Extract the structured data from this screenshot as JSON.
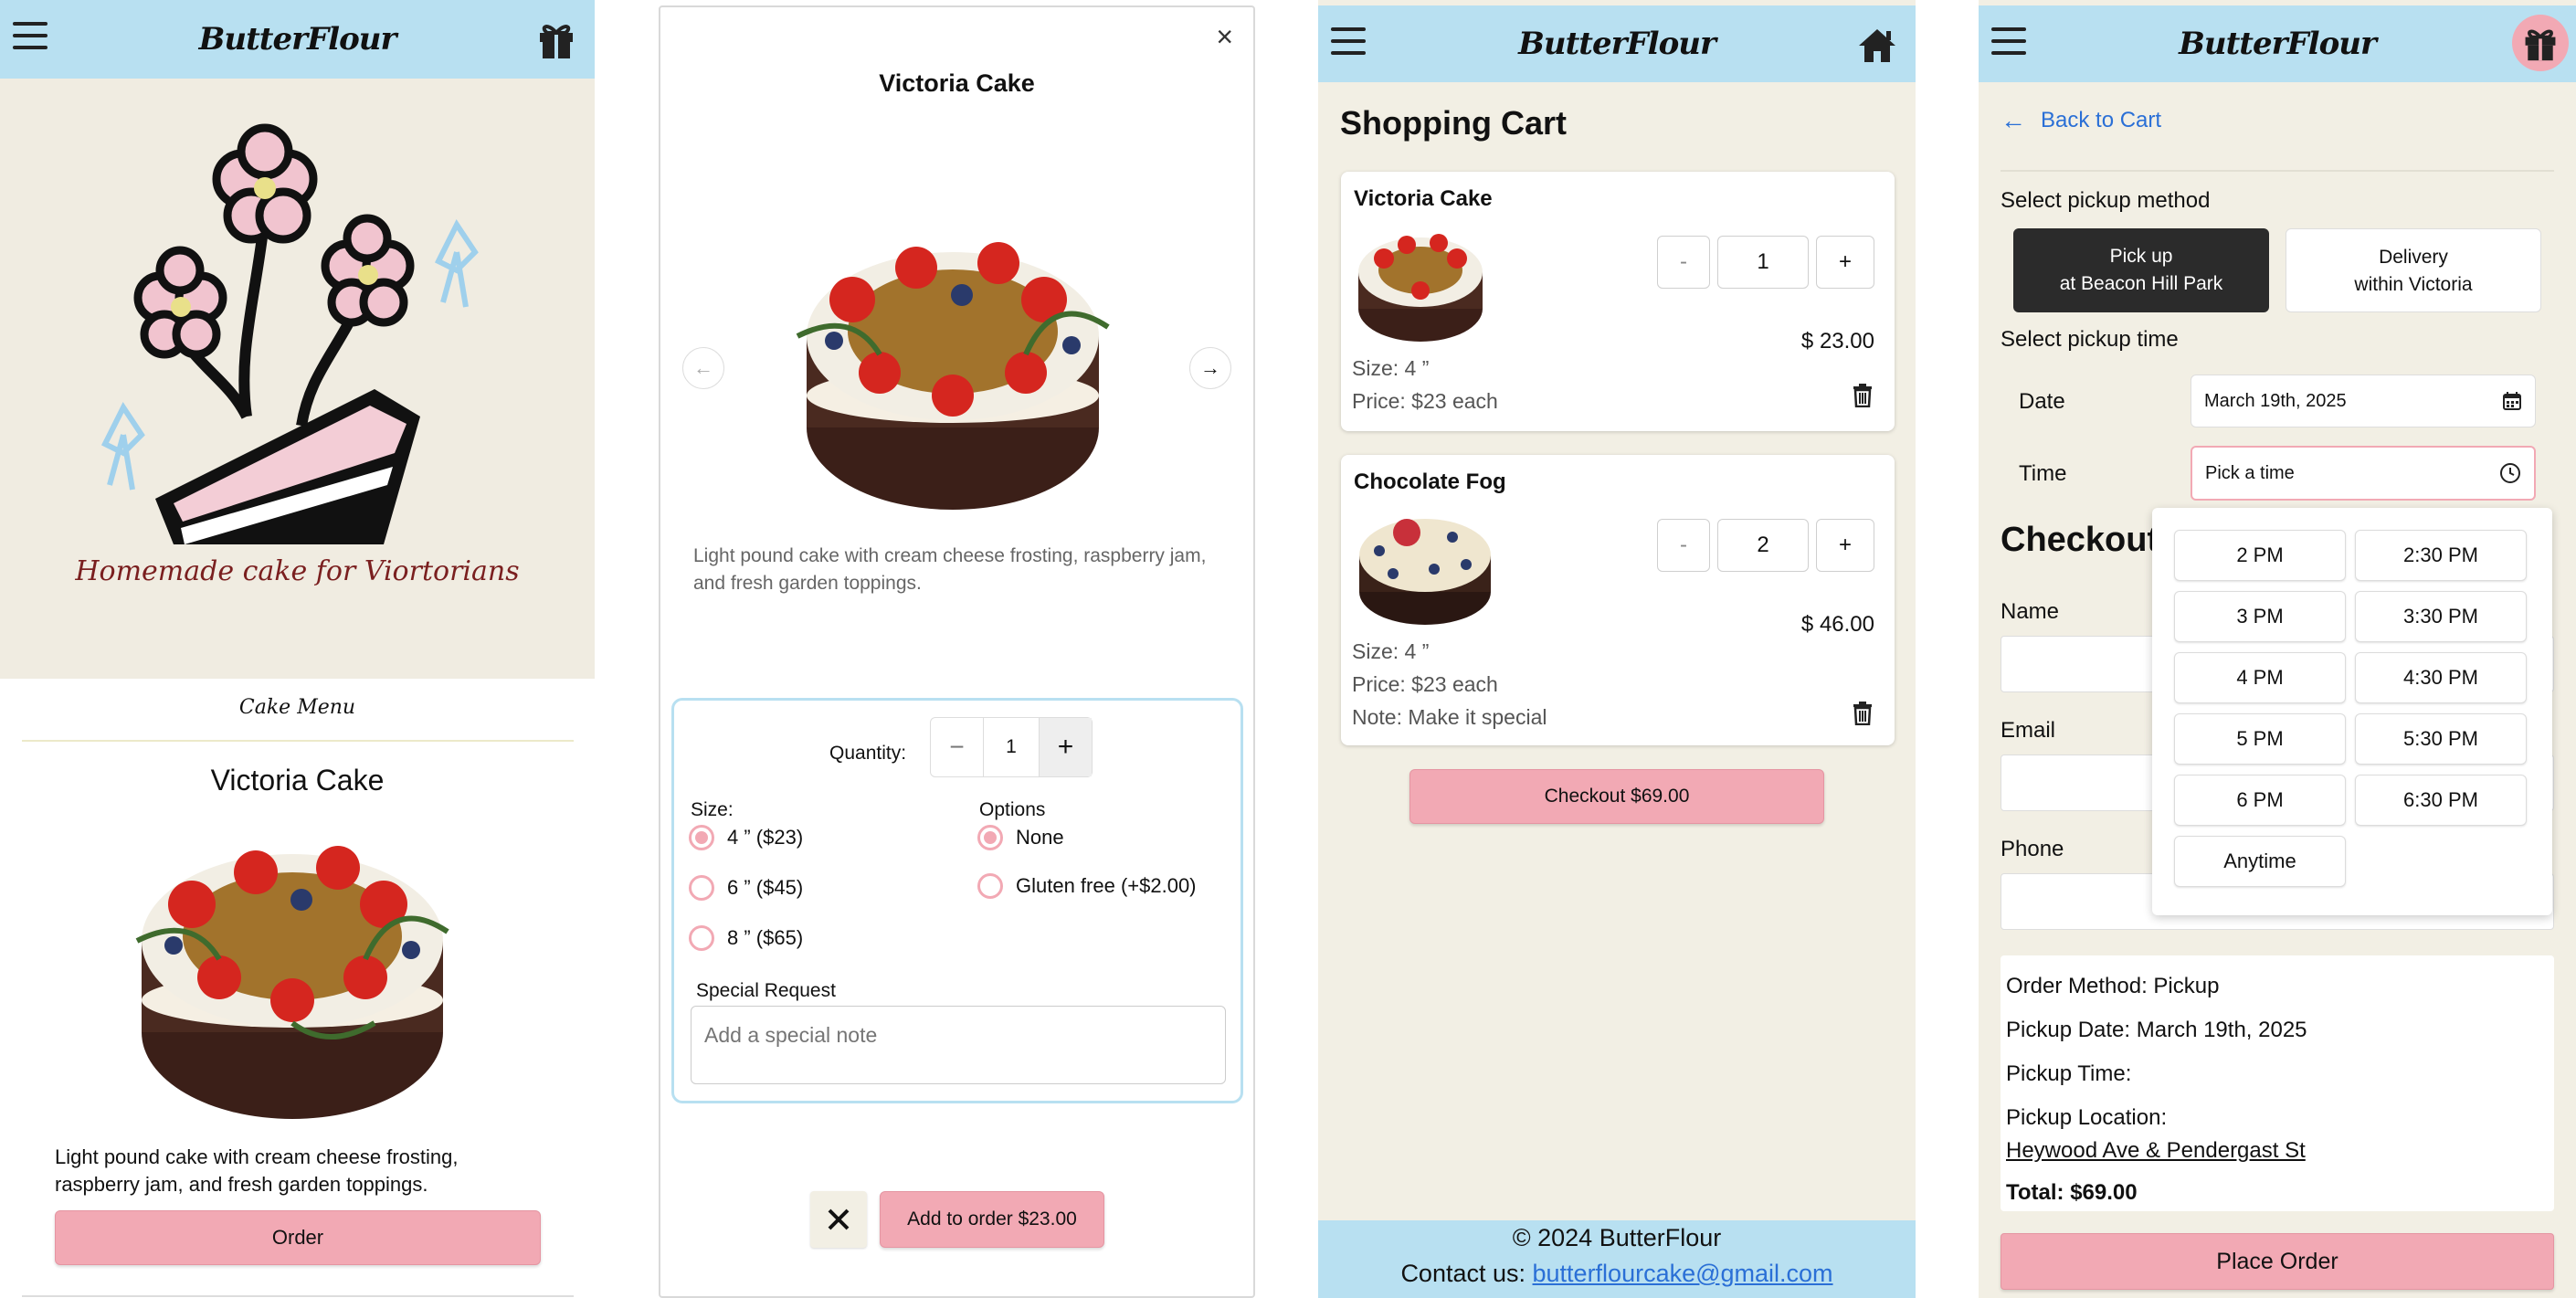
{
  "brand": {
    "logo": "ButterFlour",
    "header_bg": "#b8e0f1",
    "accent_pink": "#f2a9b4",
    "cream_bg": "#f2efe4"
  },
  "screen1": {
    "hero_tagline": "Homemade cake for Viortorians",
    "menu_label": "Cake Menu",
    "product_title": "Victoria Cake",
    "product_desc": "Light pound cake with cream cheese frosting, raspberry jam, and fresh garden toppings.",
    "order_button": "Order",
    "right_icon": "gift-icon"
  },
  "screen2": {
    "title": "Victoria Cake",
    "description": "Light pound cake with cream cheese frosting, raspberry jam, and fresh garden toppings.",
    "quantity_label": "Quantity:",
    "quantity_value": "1",
    "size_label": "Size:",
    "sizes": [
      {
        "label": "4 ” ($23)",
        "selected": true
      },
      {
        "label": "6 ” ($45)",
        "selected": false
      },
      {
        "label": "8 ” ($65)",
        "selected": false
      }
    ],
    "options_label": "Options",
    "options": [
      {
        "label": "None",
        "selected": true
      },
      {
        "label": "Gluten free (+$2.00)",
        "selected": false
      }
    ],
    "special_label": "Special Request",
    "special_placeholder": "Add a special note",
    "add_button": "Add to order $23.00",
    "minus": "−",
    "plus": "+",
    "close": "×"
  },
  "screen3": {
    "title": "Shopping Cart",
    "items": [
      {
        "name": "Victoria Cake",
        "qty": "1",
        "price": "$ 23.00",
        "size": "Size: 4 ”",
        "unit": "Price: $23 each",
        "note": ""
      },
      {
        "name": "Chocolate Fog",
        "qty": "2",
        "price": "$ 46.00",
        "size": "Size: 4 ”",
        "unit": "Price: $23 each",
        "note": "Note: Make it special"
      }
    ],
    "minus": "-",
    "plus": "+",
    "checkout_button": "Checkout $69.00",
    "footer_copy": "© 2024 ButterFlour",
    "footer_contact_label": "Contact us: ",
    "footer_email": "butterflourcake@gmail.com",
    "right_icon": "home-icon"
  },
  "screen4": {
    "back_link": "Back to Cart",
    "pickup_method_label": "Select pickup method",
    "method_pickup_line1": "Pick up",
    "method_pickup_line2": "at Beacon Hill Park",
    "method_delivery_line1": "Delivery",
    "method_delivery_line2": "within Victoria",
    "pickup_time_label": "Select pickup time",
    "date_label": "Date",
    "date_value": "March 19th, 2025",
    "time_label": "Time",
    "time_placeholder": "Pick a time",
    "checkout_heading": "Checkout",
    "name_label": "Name",
    "email_label": "Email",
    "phone_label": "Phone",
    "time_slots": [
      "2 PM",
      "2:30 PM",
      "3 PM",
      "3:30 PM",
      "4 PM",
      "4:30 PM",
      "5 PM",
      "5:30 PM",
      "6 PM",
      "6:30 PM",
      "Anytime"
    ],
    "summary_method": "Order Method: Pickup",
    "summary_date": "Pickup Date: March 19th, 2025",
    "summary_time": "Pickup Time:",
    "summary_location_label": "Pickup Location:",
    "summary_location": "Heywood Ave & Pendergast St",
    "summary_total": "Total: $69.00",
    "place_order_button": "Place Order",
    "right_icon": "gift-icon"
  }
}
